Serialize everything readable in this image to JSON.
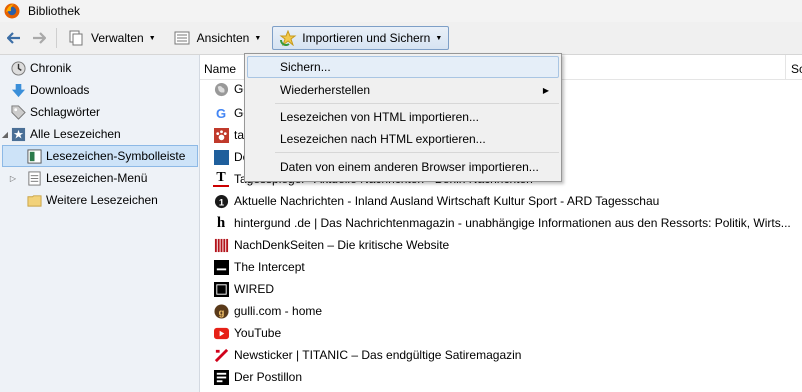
{
  "window": {
    "title": "Bibliothek"
  },
  "toolbar": {
    "manage_label": "Verwalten",
    "views_label": "Ansichten",
    "import_label": "Importieren und Sichern"
  },
  "sidebar": {
    "items": [
      {
        "label": "Chronik",
        "icon": "clock-icon"
      },
      {
        "label": "Downloads",
        "icon": "download-icon"
      },
      {
        "label": "Schlagwörter",
        "icon": "tag-icon"
      },
      {
        "label": "Alle Lesezeichen",
        "icon": "star-icon"
      },
      {
        "label": "Lesezeichen-Symbolleiste",
        "icon": "bookmarks-toolbar-icon"
      },
      {
        "label": "Lesezeichen-Menü",
        "icon": "bookmarks-menu-icon"
      },
      {
        "label": "Weitere Lesezeichen",
        "icon": "folder-icon"
      }
    ]
  },
  "columns": {
    "name": "Name",
    "second": "Sc"
  },
  "rows": [
    {
      "text": "Ge",
      "icon": "globe-icon"
    },
    {
      "text": "Go",
      "icon": "google-icon"
    },
    {
      "text": "ta",
      "icon": "paw-icon"
    },
    {
      "text": "De",
      "icon": "site-icon"
    },
    {
      "text": "Tagesspiegel - Aktuelle Nachrichten - Berlin Nachrichten",
      "icon": "tagesspiegel-icon"
    },
    {
      "text": "Aktuelle Nachrichten - Inland Ausland Wirtschaft Kultur Sport - ARD Tagesschau",
      "icon": "tagesschau-icon"
    },
    {
      "text": "hintergund .de | Das Nachrichtenmagazin - unabhängige Informationen aus den Ressorts: Politik, Wirts...",
      "icon": "hintergrund-icon"
    },
    {
      "text": "NachDenkSeiten – Die kritische Website",
      "icon": "nachdenkseiten-icon"
    },
    {
      "text": "The Intercept",
      "icon": "intercept-icon"
    },
    {
      "text": "WIRED",
      "icon": "wired-icon"
    },
    {
      "text": "gulli.com - home",
      "icon": "gulli-icon"
    },
    {
      "text": "YouTube",
      "icon": "youtube-icon"
    },
    {
      "text": "Newsticker | TITANIC – Das endgültige Satiremagazin",
      "icon": "titanic-icon"
    },
    {
      "text": "Der Postillon",
      "icon": "postillon-icon"
    }
  ],
  "menu": {
    "items": [
      {
        "label": "Sichern...",
        "submenu": false
      },
      {
        "label": "Wiederherstellen",
        "submenu": true
      },
      {
        "label": "Lesezeichen von HTML importieren...",
        "submenu": false
      },
      {
        "label": "Lesezeichen nach HTML exportieren...",
        "submenu": false
      },
      {
        "label": "Daten von einem anderen Browser importieren...",
        "submenu": false
      }
    ]
  }
}
